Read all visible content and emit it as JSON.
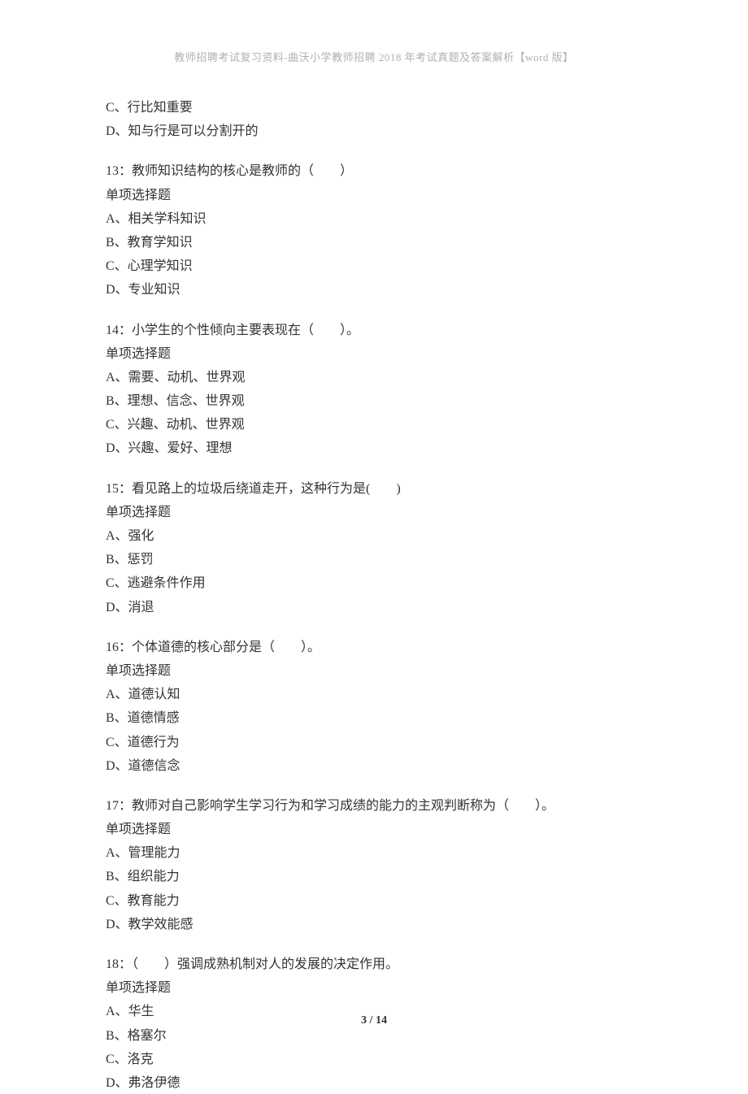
{
  "header": "教师招聘考试复习资料-曲沃小学教师招聘 2018 年考试真题及答案解析【word 版】",
  "q12_tail": {
    "optC": "C、行比知重要",
    "optD": "D、知与行是可以分割开的"
  },
  "q13": {
    "stem": "13：教师知识结构的核心是教师的（　　）",
    "type": "单项选择题",
    "optA": "A、相关学科知识",
    "optB": "B、教育学知识",
    "optC": "C、心理学知识",
    "optD": "D、专业知识"
  },
  "q14": {
    "stem": "14：小学生的个性倾向主要表现在（　　）。",
    "type": "单项选择题",
    "optA": "A、需要、动机、世界观",
    "optB": "B、理想、信念、世界观",
    "optC": "C、兴趣、动机、世界观",
    "optD": "D、兴趣、爱好、理想"
  },
  "q15": {
    "stem": "15：看见路上的垃圾后绕道走开，这种行为是(　　)",
    "type": "单项选择题",
    "optA": "A、强化",
    "optB": "B、惩罚",
    "optC": "C、逃避条件作用",
    "optD": "D、消退"
  },
  "q16": {
    "stem": "16：个体道德的核心部分是（　　）。",
    "type": "单项选择题",
    "optA": "A、道德认知",
    "optB": "B、道德情感",
    "optC": "C、道德行为",
    "optD": "D、道德信念"
  },
  "q17": {
    "stem": "17：教师对自己影响学生学习行为和学习成绩的能力的主观判断称为（　　）。",
    "type": "单项选择题",
    "optA": "A、管理能力",
    "optB": "B、组织能力",
    "optC": "C、教育能力",
    "optD": "D、教学效能感"
  },
  "q18": {
    "stem": "18：（　　）强调成熟机制对人的发展的决定作用。",
    "type": "单项选择题",
    "optA": "A、华生",
    "optB": "B、格塞尔",
    "optC": "C、洛克",
    "optD": "D、弗洛伊德"
  },
  "footer": {
    "page": "3",
    "sep": " / ",
    "total": "14"
  }
}
